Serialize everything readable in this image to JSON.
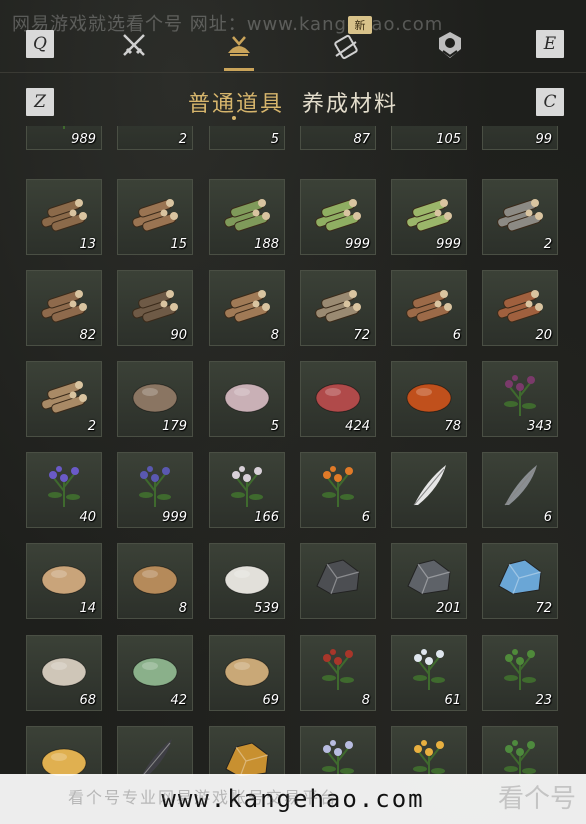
{
  "watermark_top": "网易游戏就选看个号 网址：www.kangehao.com",
  "nav": {
    "key_left": "Q",
    "key_right": "E",
    "key_sub_left": "Z",
    "key_sub_right": "C",
    "new_badge": "新",
    "icons": [
      "crossed-swords-icon",
      "pouch-icon",
      "scroll-icon",
      "emblem-icon"
    ],
    "active_index": 1
  },
  "subtabs": [
    {
      "label": "普通道具",
      "active": true
    },
    {
      "label": "养成材料",
      "active": false
    }
  ],
  "items": [
    {
      "icon": "flower-sprig-icon",
      "qty": "989",
      "color": "#c77"
    },
    {
      "icon": "sweet-potato-icon",
      "qty": "2",
      "color": "#b07a4a"
    },
    {
      "icon": "bamboo-rack-icon",
      "qty": "5",
      "color": "#9a8f78"
    },
    {
      "icon": "paper-sheet-icon",
      "qty": "87",
      "color": "#c9b48a"
    },
    {
      "icon": "cloth-bolt-icon",
      "qty": "105",
      "color": "#d2c39c"
    },
    {
      "icon": "sack-icon",
      "qty": "99",
      "color": "#c4ab7d"
    },
    {
      "icon": "log-pile-icon",
      "qty": "13",
      "color": "#8b6a4a"
    },
    {
      "icon": "log-pile-icon",
      "qty": "15",
      "color": "#9a7452"
    },
    {
      "icon": "bamboo-bundle-icon",
      "qty": "188",
      "color": "#7f9a5a"
    },
    {
      "icon": "bamboo-bundle-icon",
      "qty": "999",
      "color": "#8fae62"
    },
    {
      "icon": "bamboo-bundle-icon",
      "qty": "999",
      "color": "#9bb66a"
    },
    {
      "icon": "log-pile-icon",
      "qty": "2",
      "color": "#8c8a84"
    },
    {
      "icon": "log-pile-icon",
      "qty": "82",
      "color": "#8e6a4c"
    },
    {
      "icon": "log-pile-icon",
      "qty": "90",
      "color": "#6e5a46"
    },
    {
      "icon": "log-pile-icon",
      "qty": "8",
      "color": "#a07a56"
    },
    {
      "icon": "log-pile-icon",
      "qty": "72",
      "color": "#9a8a72"
    },
    {
      "icon": "log-pile-icon",
      "qty": "6",
      "color": "#9c6a48"
    },
    {
      "icon": "log-pile-icon",
      "qty": "20",
      "color": "#a0603e"
    },
    {
      "icon": "log-pile-icon",
      "qty": "2",
      "color": "#a98a66"
    },
    {
      "icon": "animal-hide-icon",
      "qty": "179",
      "color": "#8a7562"
    },
    {
      "icon": "intestine-icon",
      "qty": "5",
      "color": "#c9b0b6"
    },
    {
      "icon": "raw-meat-icon",
      "qty": "424",
      "color": "#b04a4a"
    },
    {
      "icon": "chestnut-icon",
      "qty": "78",
      "color": "#c0501c"
    },
    {
      "icon": "purple-flower-icon",
      "qty": "343",
      "color": "#7a3a6a"
    },
    {
      "icon": "lavender-herb-icon",
      "qty": "40",
      "color": "#6a5ac8"
    },
    {
      "icon": "lavender-herb-icon",
      "qty": "999",
      "color": "#5a58b0"
    },
    {
      "icon": "white-flower-icon",
      "qty": "166",
      "color": "#d8d0d8"
    },
    {
      "icon": "orange-flower-icon",
      "qty": "6",
      "color": "#e07a28"
    },
    {
      "icon": "white-feather-icon",
      "qty": "",
      "color": "#e6e6e6"
    },
    {
      "icon": "grey-feather-icon",
      "qty": "6",
      "color": "#8a8e92"
    },
    {
      "icon": "clay-bowl-icon",
      "qty": "14",
      "color": "#c9a47a"
    },
    {
      "icon": "fur-pelt-icon",
      "qty": "8",
      "color": "#b58a5a"
    },
    {
      "icon": "white-fleece-icon",
      "qty": "539",
      "color": "#e2e0da"
    },
    {
      "icon": "dark-ore-icon",
      "qty": "",
      "color": "#4c4e52"
    },
    {
      "icon": "grey-ore-icon",
      "qty": "201",
      "color": "#5e6268"
    },
    {
      "icon": "blue-ore-icon",
      "qty": "72",
      "color": "#6aa6d6"
    },
    {
      "icon": "bone-claw-icon",
      "qty": "68",
      "color": "#cfc6b8"
    },
    {
      "icon": "winter-melon-icon",
      "qty": "42",
      "color": "#8ab08a"
    },
    {
      "icon": "grain-sacks-icon",
      "qty": "69",
      "color": "#c9a877"
    },
    {
      "icon": "red-berry-shrub-icon",
      "qty": "8",
      "color": "#a8362a"
    },
    {
      "icon": "white-blossom-icon",
      "qty": "61",
      "color": "#dfe6ee"
    },
    {
      "icon": "green-herb-icon",
      "qty": "23",
      "color": "#4f8a3a"
    },
    {
      "icon": "torch-spark-icon",
      "qty": "",
      "color": "#e0b050"
    },
    {
      "icon": "dark-feather-icon",
      "qty": "",
      "color": "#3e3e44"
    },
    {
      "icon": "gold-nugget-icon",
      "qty": "",
      "color": "#c89030"
    },
    {
      "icon": "spider-lily-icon",
      "qty": "",
      "color": "#b8bce0"
    },
    {
      "icon": "fruit-branch-icon",
      "qty": "",
      "color": "#e8b040"
    },
    {
      "icon": "potted-plant-icon",
      "qty": "",
      "color": "#4e8a3e"
    }
  ],
  "banner": {
    "url": "www.kangehao.com",
    "cn": "看个号专业网易游戏账号交易平台"
  }
}
